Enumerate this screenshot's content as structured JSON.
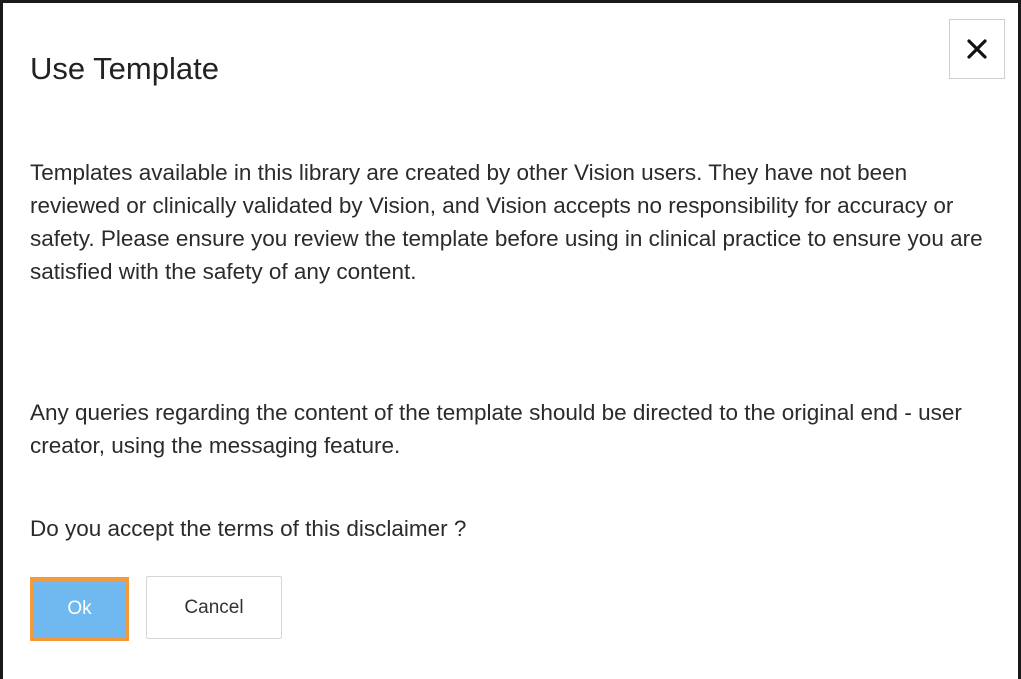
{
  "dialog": {
    "title": "Use Template",
    "close_icon": "close-icon",
    "paragraphs": [
      "Templates available in this library are created by other Vision users. They have not been reviewed or clinically validated by Vision, and Vision accepts no responsibility for accuracy or safety. Please ensure you review the template before using in clinical practice to ensure you are satisfied with the safety of any content.",
      "Any queries regarding the content of the template should be directed to the original end - user creator, using the messaging feature.",
      "Do you accept the terms of this disclaimer ?"
    ],
    "buttons": {
      "ok_label": "Ok",
      "cancel_label": "Cancel"
    }
  },
  "colors": {
    "ok_background": "#6fb8f0",
    "ok_focus_border": "#f59a3a",
    "text": "#2b2b2b"
  }
}
